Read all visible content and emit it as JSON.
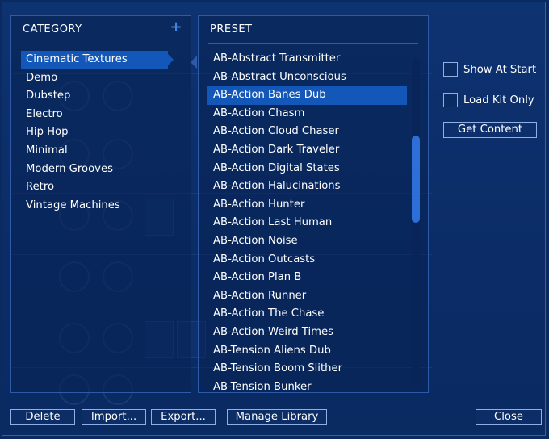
{
  "category": {
    "header": "CATEGORY",
    "add_icon": "plus-icon",
    "selected_index": 0,
    "items": [
      "Cinematic Textures",
      "Demo",
      "Dubstep",
      "Electro",
      "Hip Hop",
      "Minimal",
      "Modern Grooves",
      "Retro",
      "Vintage Machines"
    ]
  },
  "preset": {
    "header": "PRESET",
    "selected_index": 2,
    "items": [
      "AB-Abstract Transmitter",
      "AB-Abstract Unconscious",
      "AB-Action Banes Dub",
      "AB-Action Chasm",
      "AB-Action Cloud Chaser",
      "AB-Action Dark Traveler",
      "AB-Action Digital States",
      "AB-Action Halucinations",
      "AB-Action Hunter",
      "AB-Action Last Human",
      "AB-Action Noise",
      "AB-Action Outcasts",
      "AB-Action Plan B",
      "AB-Action Runner",
      "AB-Action The Chase",
      "AB-Action Weird Times",
      "AB-Tension Aliens Dub",
      "AB-Tension Boom Slither",
      "AB-Tension Bunker"
    ]
  },
  "options": {
    "show_at_start": "Show At Start",
    "load_kit_only": "Load Kit Only",
    "get_content": "Get Content"
  },
  "footer": {
    "delete": "Delete",
    "import": "Import...",
    "export": "Export...",
    "manage_library": "Manage Library",
    "close": "Close"
  },
  "colors": {
    "background": "#0b2a60",
    "panel_border": "#2f5aa8",
    "selection": "#1357b8",
    "accent": "#3d86e6"
  }
}
